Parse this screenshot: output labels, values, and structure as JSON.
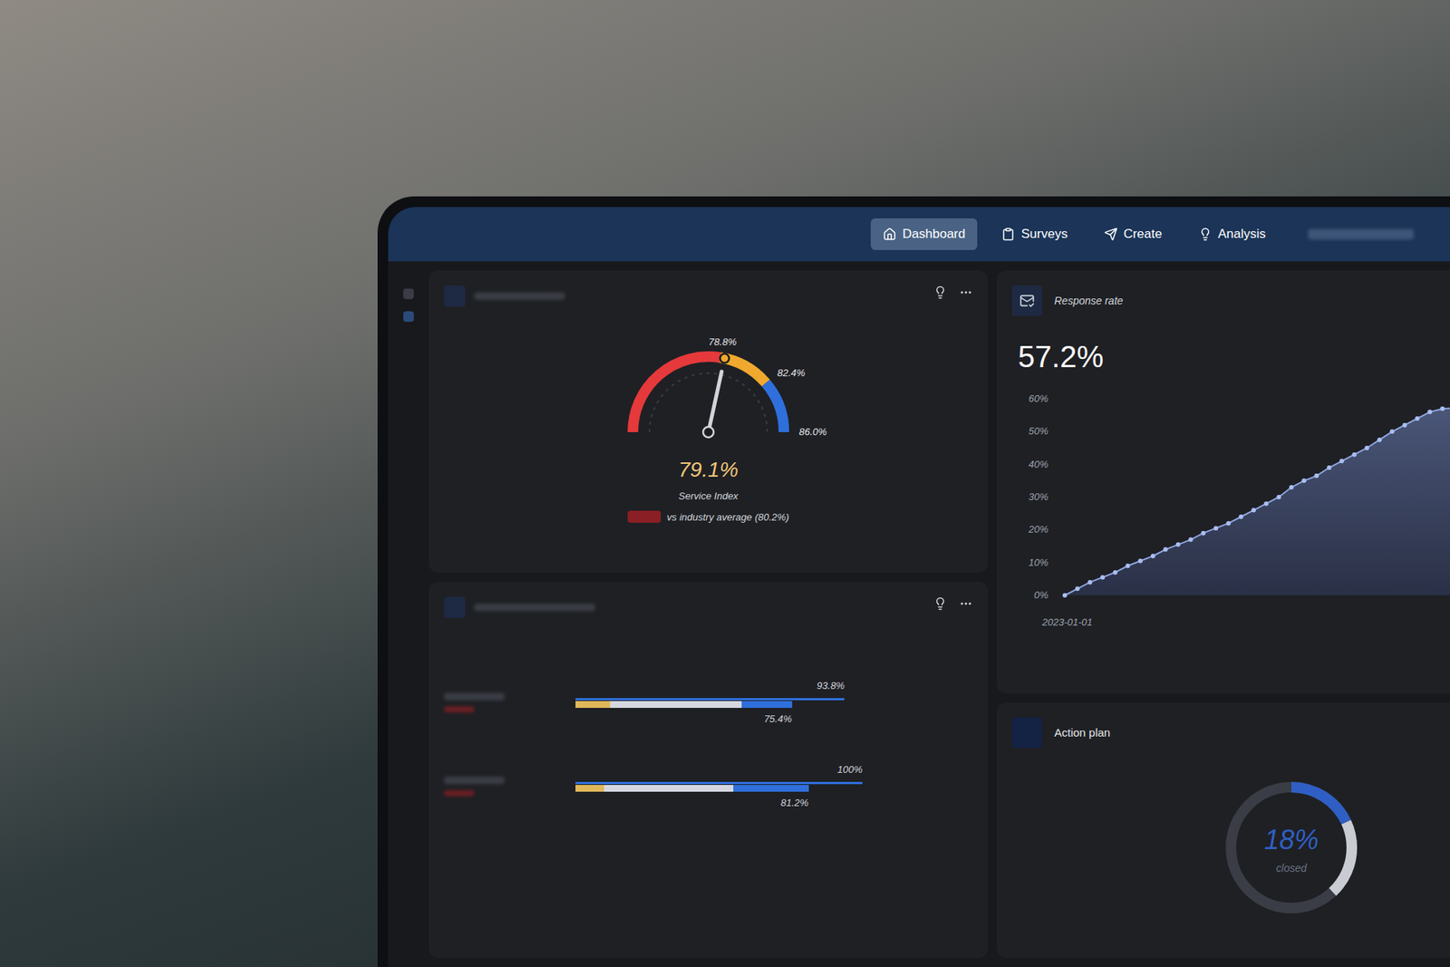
{
  "nav": {
    "tabs": [
      {
        "label": "Dashboard",
        "selected": true
      },
      {
        "label": "Surveys",
        "selected": false
      },
      {
        "label": "Create",
        "selected": false
      },
      {
        "label": "Analysis",
        "selected": false
      }
    ]
  },
  "gauge_card": {
    "value": "79.1%",
    "caption": "Service Index",
    "comparison": "vs industry average (80.2%)",
    "gauge": {
      "min": 70,
      "max": 86,
      "needle": 79.1,
      "bands": [
        {
          "to": 78.8,
          "label": "78.8%",
          "color": "#e5393b"
        },
        {
          "to": 82.4,
          "label": "82.4%",
          "color": "#f0a92e"
        },
        {
          "to": 86,
          "label": "86.0%",
          "color": "#2f6fdc"
        }
      ]
    }
  },
  "bars_card": {
    "rows": [
      {
        "base_level": 0.12,
        "mid_level": 0.58,
        "score_level": 0.754,
        "score": "75.4%",
        "target_level": 0.938,
        "target": "93.8%"
      },
      {
        "base_level": 0.1,
        "mid_level": 0.55,
        "score_level": 0.812,
        "score": "81.2%",
        "target_level": 1,
        "target": "100%"
      }
    ]
  },
  "response_card": {
    "title": "Response rate",
    "value": "57.2%",
    "chart": {
      "y_ticks": [
        "60%",
        "50%",
        "40%",
        "30%",
        "20%",
        "10%",
        "0%"
      ],
      "y_max": 60,
      "x_label": "2023-01-01",
      "values": [
        0,
        2,
        4,
        5.5,
        7,
        9,
        10.5,
        12,
        14,
        15.5,
        17,
        19,
        20.5,
        22,
        24,
        26,
        28,
        30,
        33,
        35,
        36.5,
        39,
        41,
        43,
        45,
        47.5,
        50,
        52,
        54,
        56,
        57,
        57.2,
        57.2,
        57.2
      ]
    }
  },
  "action_card": {
    "title": "Action plan",
    "value": "18%",
    "caption": "closed",
    "level": 0.18,
    "in_progress_level": 0.2
  }
}
